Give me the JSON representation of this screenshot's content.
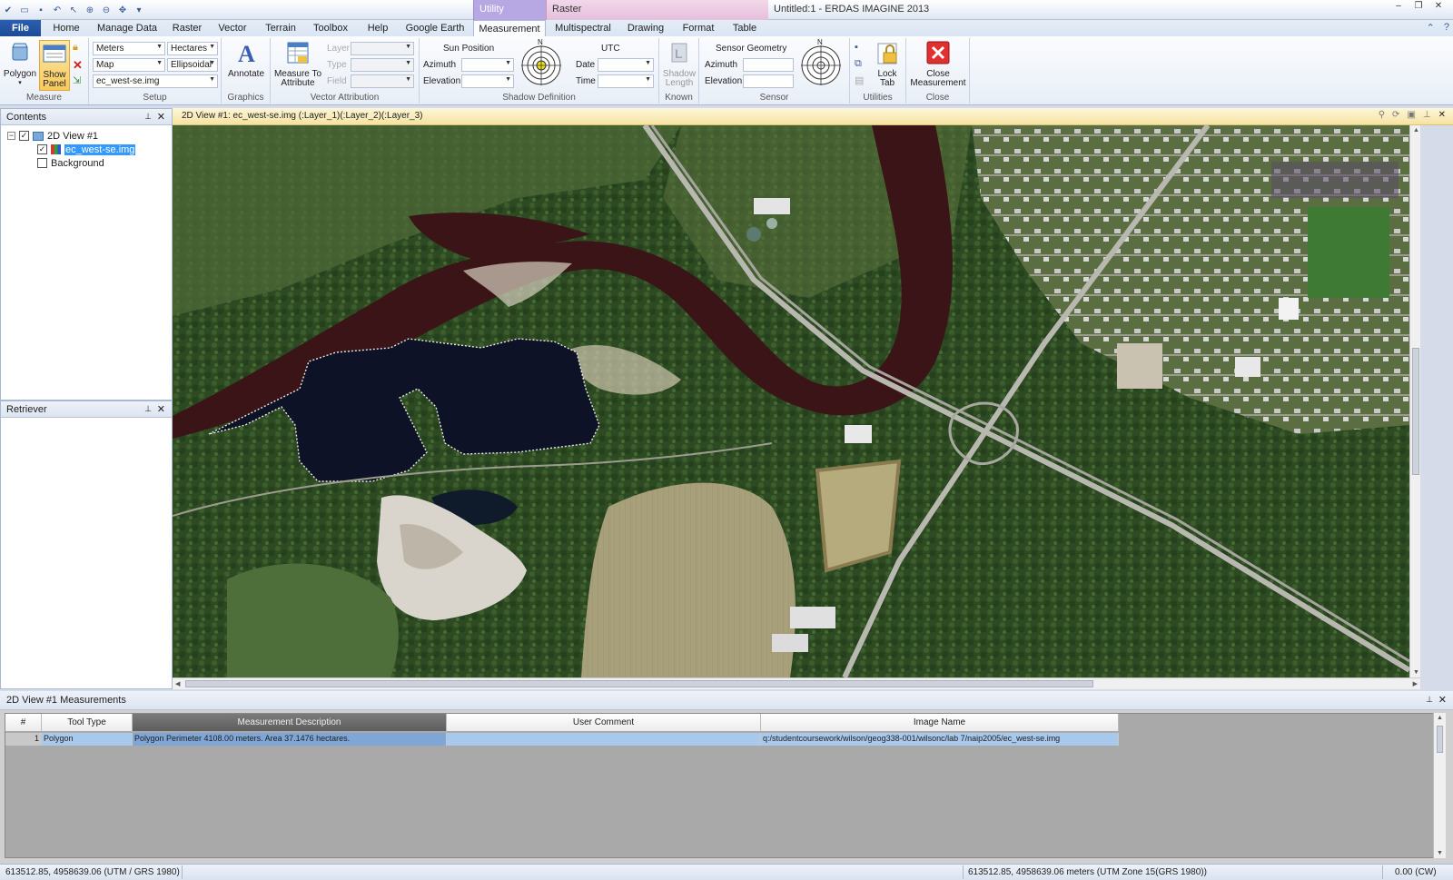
{
  "window": {
    "title": "Untitled:1 - ERDAS IMAGINE 2013",
    "context_tabs": [
      "Utility",
      "Raster"
    ]
  },
  "ribbon_tabs": {
    "file": "File",
    "tabs": [
      "Home",
      "Manage Data",
      "Raster",
      "Vector",
      "Terrain",
      "Toolbox",
      "Help",
      "Google Earth",
      "Measurement",
      "Multispectral",
      "Drawing",
      "Format",
      "Table"
    ],
    "active": "Measurement"
  },
  "ribbon": {
    "measure": {
      "polygon_label": "Polygon",
      "show_panel_label": "Show Panel",
      "group_label": "Measure"
    },
    "setup": {
      "units": "Meters",
      "area_units": "Hectares",
      "coord_mode": "Map",
      "ellipsoid": "Ellipsoidal",
      "image": "ec_west-se.img",
      "group_label": "Setup"
    },
    "graphics": {
      "annotate_label": "Annotate",
      "group_label": "Graphics"
    },
    "vector_attribution": {
      "measure_to_attribute_label": "Measure To Attribute",
      "layer_label": "Layer",
      "type_label": "Type",
      "field_label": "Field",
      "group_label": "Vector Attribution"
    },
    "shadow": {
      "sun_position_label": "Sun Position",
      "azimuth_label": "Azimuth",
      "elevation_label": "Elevation",
      "utc_label": "UTC",
      "date_label": "Date",
      "time_label": "Time",
      "north_label": "N",
      "group_label": "Shadow Definition"
    },
    "known": {
      "shadow_length_label": "Shadow Length",
      "group_label": "Known"
    },
    "sensor": {
      "sensor_geometry_label": "Sensor Geometry",
      "azimuth_label": "Azimuth",
      "elevation_label": "Elevation",
      "north_label": "N",
      "group_label": "Sensor"
    },
    "utilities": {
      "lock_tab_label": "Lock Tab",
      "group_label": "Utilities"
    },
    "close": {
      "close_measurement_label": "Close Measurement",
      "group_label": "Close"
    }
  },
  "contents": {
    "title": "Contents",
    "view_name": "2D View #1",
    "layer_name": "ec_west-se.img",
    "background_label": "Background"
  },
  "retriever": {
    "title": "Retriever"
  },
  "view": {
    "title": "2D View #1: ec_west-se.img (:Layer_1)(:Layer_2)(:Layer_3)"
  },
  "measurements": {
    "title": "2D View #1 Measurements",
    "columns": [
      "#",
      "Tool Type",
      "Measurement Description",
      "User Comment",
      "Image Name"
    ],
    "rows": [
      {
        "num": "1",
        "tool_type": "Polygon",
        "description": "Polygon Perimeter 4108.00 meters. Area 37.1476 hectares.",
        "comment": "",
        "image_name": "q:/studentcoursework/wilson/geog338-001/wilsonc/lab 7/naip2005/ec_west-se.img"
      }
    ]
  },
  "status": {
    "left_coords": "613512.85, 4958639.06  (UTM / GRS 1980)",
    "right_coords": "613512.85, 4958639.06 meters (UTM Zone 15(GRS 1980))",
    "rotation": "0.00 (CW)"
  },
  "colors": {
    "accent_blue": "#2b5fb2",
    "selection": "#3399ff",
    "view_header": "#f5e3a3",
    "river": "#3a1416",
    "lake": "#0d1226"
  }
}
